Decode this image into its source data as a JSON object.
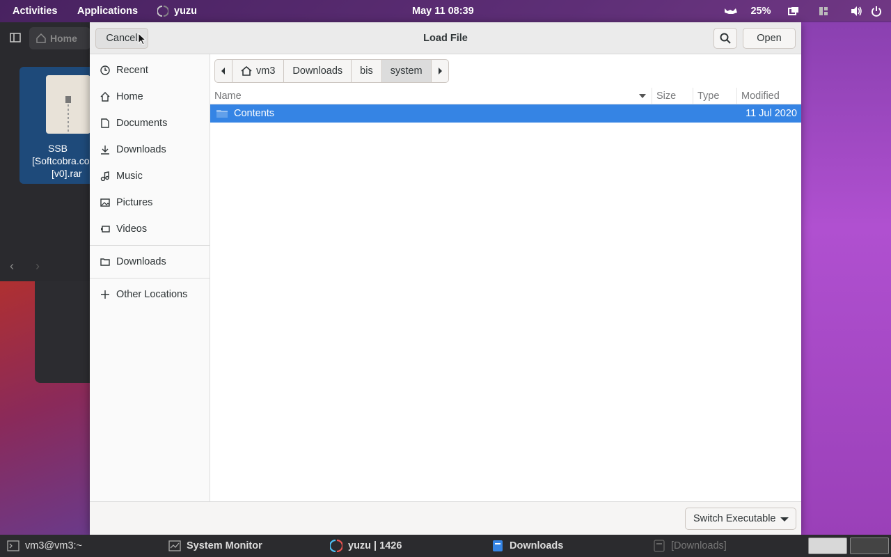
{
  "topbar": {
    "activities": "Activities",
    "applications": "Applications",
    "app_name": "yuzu",
    "clock": "May 11  08:39",
    "battery": "25%"
  },
  "background_window": {
    "home_label": "Home",
    "file_label_lines": [
      "SSB",
      "[Softcobra.co",
      "[v0].rar"
    ]
  },
  "dialog": {
    "title": "Load File",
    "cancel_label": "Cancel",
    "open_label": "Open",
    "sidebar": {
      "items": [
        {
          "label": "Recent",
          "icon": "clock-icon"
        },
        {
          "label": "Home",
          "icon": "home-icon"
        },
        {
          "label": "Documents",
          "icon": "document-icon"
        },
        {
          "label": "Downloads",
          "icon": "download-icon"
        },
        {
          "label": "Music",
          "icon": "music-icon"
        },
        {
          "label": "Pictures",
          "icon": "picture-icon"
        },
        {
          "label": "Videos",
          "icon": "video-icon"
        }
      ],
      "bookmarks": [
        {
          "label": "Downloads",
          "icon": "folder-icon"
        }
      ],
      "other": {
        "label": "Other Locations",
        "icon": "plus-icon"
      }
    },
    "pathbar": {
      "crumbs": [
        "vm3",
        "Downloads",
        "bis",
        "system"
      ],
      "active": "system"
    },
    "columns": {
      "name": "Name",
      "size": "Size",
      "type": "Type",
      "modified": "Modified"
    },
    "files": [
      {
        "name": "Contents",
        "size": "",
        "type": "",
        "modified": "11 Jul 2020",
        "kind": "folder",
        "selected": true
      }
    ],
    "filter": "Switch Executable"
  },
  "taskbar": {
    "tasks": [
      {
        "label": "vm3@vm3:~",
        "icon": "terminal-icon"
      },
      {
        "label": "System Monitor",
        "icon": "monitor-icon"
      },
      {
        "label": "yuzu | 1426",
        "icon": "yuzu-icon"
      },
      {
        "label": "Downloads",
        "icon": "files-icon"
      },
      {
        "label": "[Downloads]",
        "icon": "files-icon"
      }
    ]
  },
  "colors": {
    "accent": "#3584e4",
    "headerbar": "#ebebeb",
    "taskbar": "#2b2b2e"
  }
}
